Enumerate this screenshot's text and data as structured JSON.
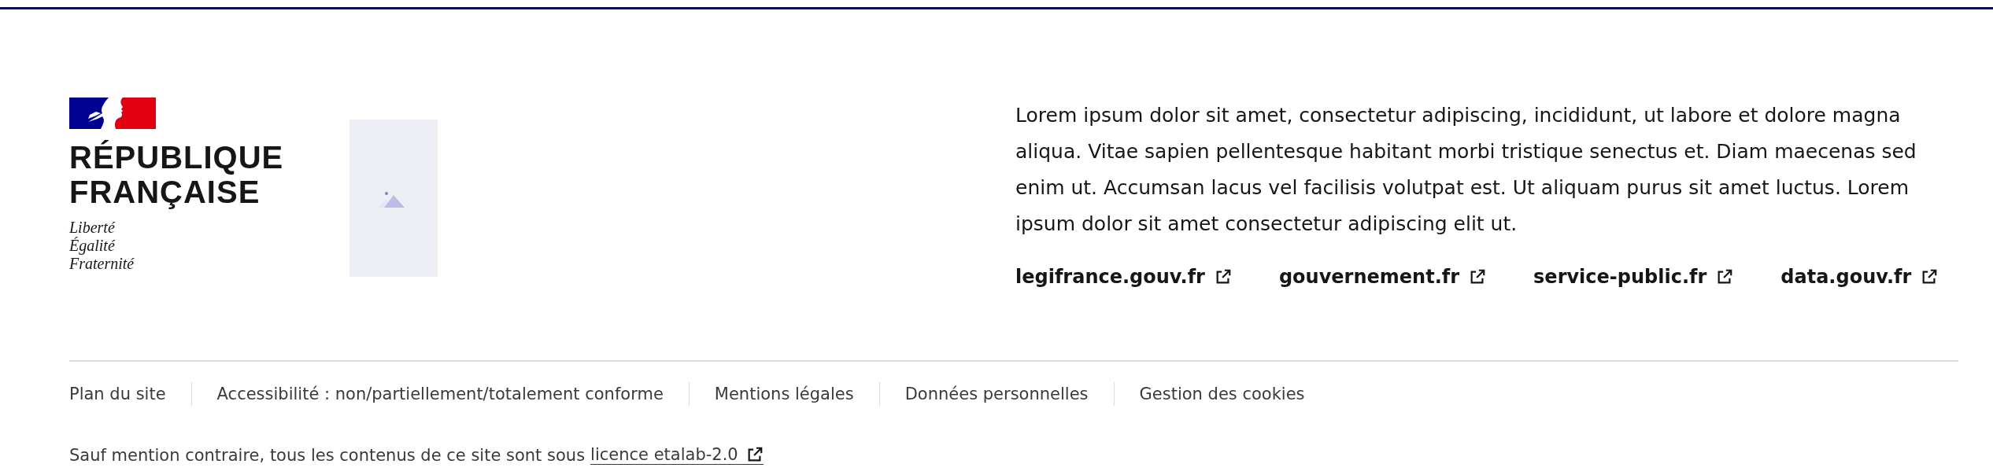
{
  "brand": {
    "title_lines": [
      "RÉPUBLIQUE",
      "FRANÇAISE"
    ],
    "motto_lines": [
      "Liberté",
      "Égalité",
      "Fraternité"
    ]
  },
  "description": "Lorem ipsum dolor sit amet, consectetur adipiscing, incididunt, ut labore et dolore magna aliqua. Vitae sapien pellentesque habitant morbi tristique senectus et. Diam maecenas sed enim ut. Accumsan lacus vel facilisis volutpat est. Ut aliquam purus sit amet luctus. Lorem ipsum dolor sit amet consectetur adipiscing elit ut.",
  "content_links": [
    {
      "label": "legifrance.gouv.fr"
    },
    {
      "label": "gouvernement.fr"
    },
    {
      "label": "service-public.fr"
    },
    {
      "label": "data.gouv.fr"
    }
  ],
  "bottom_links": [
    "Plan du site",
    "Accessibilité : non/partiellement/totalement conforme",
    "Mentions légales",
    "Données personnelles",
    "Gestion des cookies"
  ],
  "license": {
    "text": "Sauf mention contraire, tous les contenus de ce site sont sous ",
    "link": "licence etalab-2.0"
  }
}
